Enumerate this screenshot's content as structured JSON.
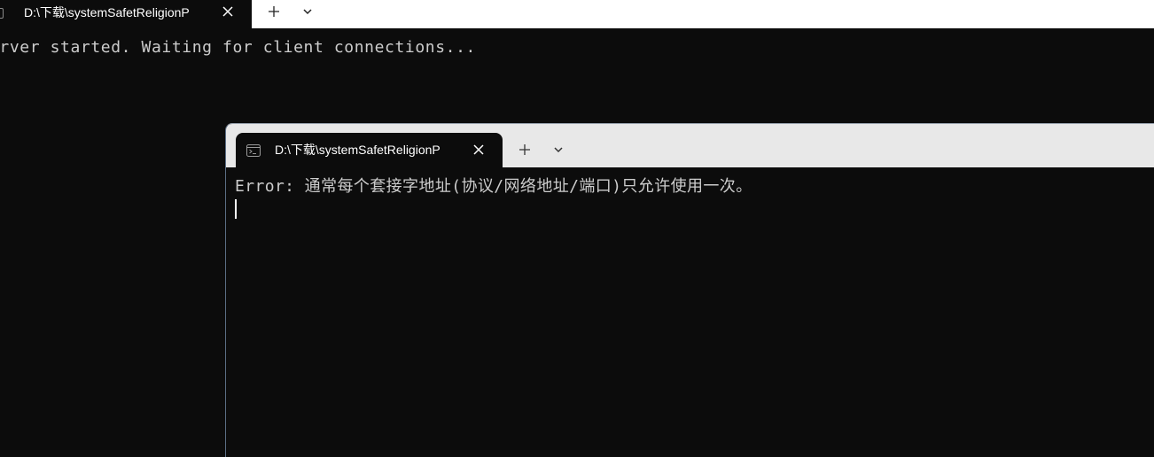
{
  "back_window": {
    "tab": {
      "title": "D:\\下载\\systemSafetReligionP"
    },
    "console": {
      "line1": "erver started. Waiting for client connections..."
    }
  },
  "front_window": {
    "tab": {
      "title": "D:\\下载\\systemSafetReligionP"
    },
    "console": {
      "line1": "Error: 通常每个套接字地址(协议/网络地址/端口)只允许使用一次。"
    }
  },
  "icons": {
    "tab_icon": "terminal-icon",
    "close": "close-icon",
    "new_tab": "plus-icon",
    "dropdown": "chevron-down-icon"
  },
  "colors": {
    "console_background": "#0c0c0c",
    "console_text": "#cccccc",
    "back_titlebar": "#ffffff",
    "front_titlebar": "#e8e8e8",
    "tab_text": "#ffffff"
  }
}
